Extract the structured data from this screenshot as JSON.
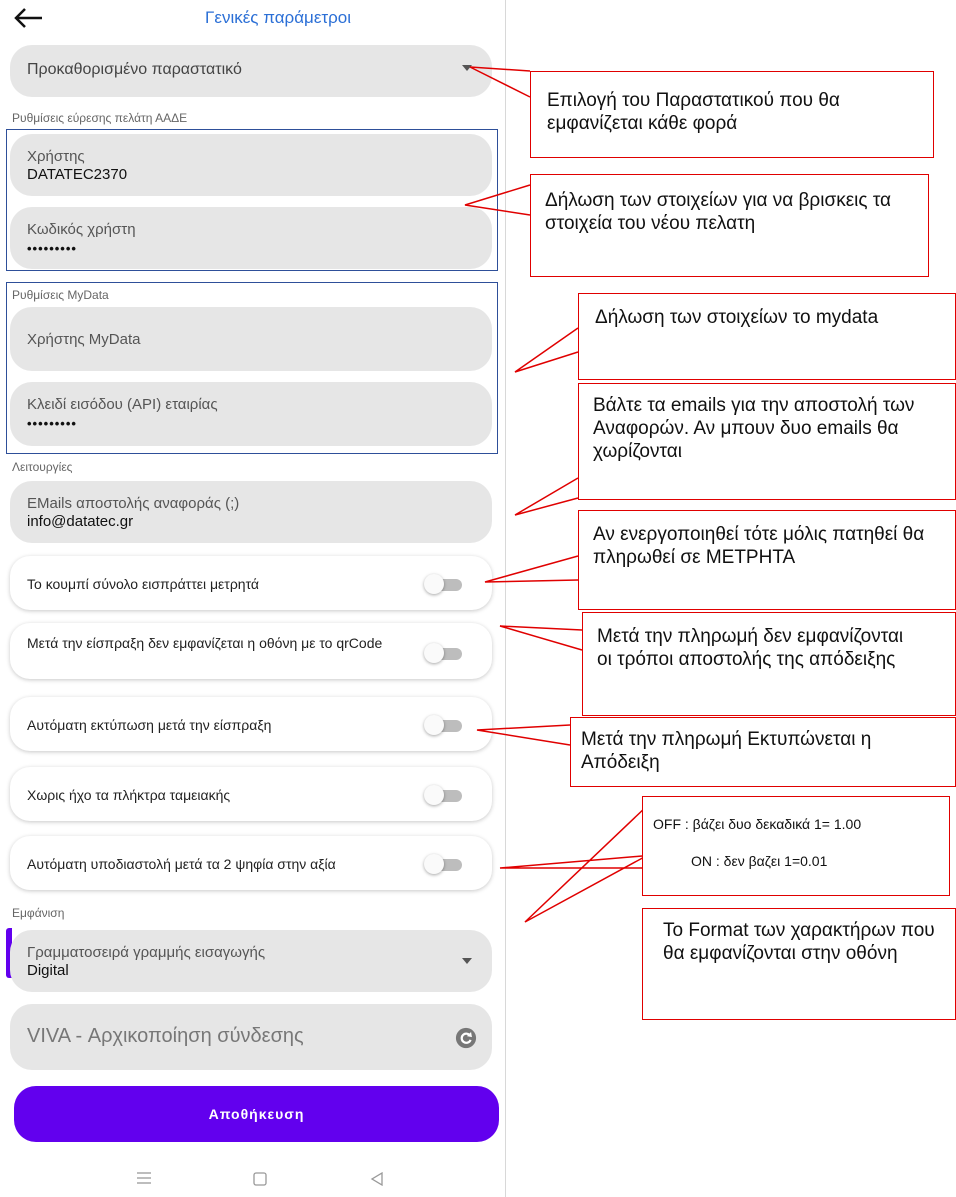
{
  "header": {
    "title": "Γενικές παράμετροι",
    "back_icon": "arrow-left-icon"
  },
  "default_document": {
    "label": "Προκαθορισμένο παραστατικό"
  },
  "aade_settings": {
    "section_label": "Ρυθμίσεις εύρεσης πελάτη ΑΑΔΕ",
    "user_label": "Χρήστης",
    "user_value": "DATATEC2370",
    "password_label": "Κωδικός χρήστη",
    "password_value": "•••••••••"
  },
  "mydata_settings": {
    "section_label": "Ρυθμίσεις MyData",
    "user_label": "Χρήστης MyData",
    "api_key_label": "Κλειδί εισόδου (API) εταιρίας",
    "api_key_value": "•••••••••"
  },
  "functions": {
    "section_label": "Λειτουργίες",
    "emails_label": "EMails αποστολής αναφοράς (;)",
    "emails_value": "info@datatec.gr",
    "toggles": [
      {
        "label": "Το κουμπί σύνολο εισπράττει μετρητά",
        "on": false
      },
      {
        "label": "Μετά την είσπραξη δεν εμφανίζεται η οθόνη με το qrCode",
        "on": false
      },
      {
        "label": "Αυτόματη εκτύπωση μετά την είσπραξη",
        "on": false
      },
      {
        "label": "Χωρις ήχο τα πλήκτρα ταμειακής",
        "on": false
      },
      {
        "label": "Αυτόματη υποδιαστολή μετά τα 2 ψηφία στην αξία",
        "on": false
      }
    ]
  },
  "appearance": {
    "section_label": "Εμφάνιση",
    "font_label": "Γραμματοσειρά γραμμής εισαγωγής",
    "font_value": "Digital",
    "viva_label": "VIVA - Αρχικοποίηση σύνδεσης"
  },
  "save_button": {
    "label": "Αποθήκευση"
  },
  "nav_bar": {
    "icons": [
      "menu-icon",
      "home-square-icon",
      "back-triangle-icon"
    ]
  },
  "callouts": [
    {
      "text": "Επιλογή του Παραστατικού που θα εμφανίζεται κάθε φορά"
    },
    {
      "text": "Δήλωση των  στοιχείων για να βρισκεις τα στοιχεία του νέου πελατη"
    },
    {
      "text": "Δήλωση των  στοιχείων το mydata"
    },
    {
      "text": "Βάλτε τα emails για την αποστολή των Αναφορών. Αν μπουν δυο emails θα χωρίζονται"
    },
    {
      "text": "Αν ενεργοποιηθεί τότε μόλις πατηθεί θα πληρωθεί σε ΜΕΤΡΗΤΑ"
    },
    {
      "text": "Μετά την πληρωμή δεν εμφανίζονται οι τρόποι αποστολής της απόδειξης"
    },
    {
      "text": "Μετά την πληρωμή Εκτυπώνεται η Απόδειξη"
    },
    {
      "line1": "OFF : βάζει δυο δεκαδικά   1= 1.00",
      "line2": "ON : δεν βαζει    1=0.01"
    },
    {
      "text": "Το Format των χαρακτήρων που θα εμφανίζονται στην οθόνη"
    }
  ],
  "colors": {
    "accent": "#6200ee",
    "title": "#2b6fd6",
    "callout_border": "#e00000",
    "group_border": "#2e4f99"
  }
}
